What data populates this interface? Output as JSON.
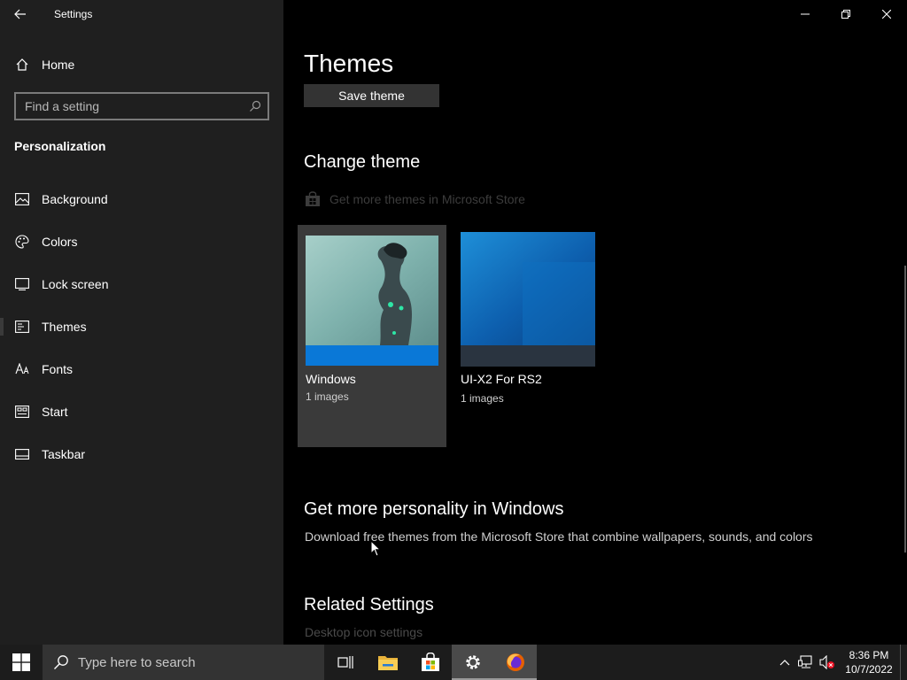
{
  "window": {
    "app_title": "Settings"
  },
  "sidebar": {
    "home_label": "Home",
    "search_placeholder": "Find a setting",
    "section_title": "Personalization",
    "items": [
      {
        "label": "Background",
        "icon": "image-icon"
      },
      {
        "label": "Colors",
        "icon": "palette-icon"
      },
      {
        "label": "Lock screen",
        "icon": "lock-screen-icon"
      },
      {
        "label": "Themes",
        "icon": "themes-icon",
        "selected": true
      },
      {
        "label": "Fonts",
        "icon": "fonts-icon"
      },
      {
        "label": "Start",
        "icon": "start-layout-icon"
      },
      {
        "label": "Taskbar",
        "icon": "taskbar-icon"
      }
    ]
  },
  "main": {
    "page_title": "Themes",
    "save_theme_label": "Save theme",
    "change_theme_heading": "Change theme",
    "store_link_label": "Get more themes in Microsoft Store",
    "themes": [
      {
        "name": "Windows",
        "count": "1 images",
        "selected": true
      },
      {
        "name": "UI-X2 For RS2",
        "count": "1 images",
        "selected": false
      }
    ],
    "personality_heading": "Get more personality in Windows",
    "personality_desc": "Download free themes from the Microsoft Store that combine wallpapers, sounds, and colors",
    "related_heading": "Related Settings",
    "related_link": "Desktop icon settings"
  },
  "taskbar": {
    "search_placeholder": "Type here to search",
    "time": "8:36 PM",
    "date": "10/7/2022"
  },
  "colors": {
    "sidebar_bg": "#1f1f1f",
    "main_bg": "#000000",
    "accent_blue": "#0a78d7",
    "taskbar_bg": "#1c1c1c"
  }
}
